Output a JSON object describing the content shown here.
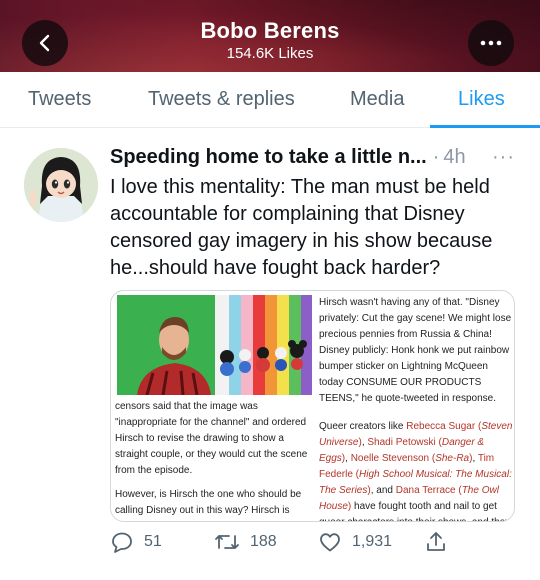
{
  "header": {
    "name": "Bobo Berens",
    "likes": "154.6K Likes"
  },
  "tabs": [
    {
      "label": "Tweets",
      "active": false
    },
    {
      "label": "Tweets & replies",
      "active": false
    },
    {
      "label": "Media",
      "active": false
    },
    {
      "label": "Likes",
      "active": true
    }
  ],
  "tweet": {
    "title": "Speeding home to take a little n...",
    "separator": "·",
    "time": "4h",
    "more": "···",
    "text": "I love this mentality: The man must be held accountable for complaining that Disney censored gay imagery in his show because he...should have fought back harder?",
    "media": {
      "left_p1": "censors said that the image was \"inappropriate for the channel\" and ordered Hirsch to revise the drawing to show a straight couple, or they would cut the scene from the episode.",
      "left_p2": "However, is Hirsch the one who should be calling Disney out in this way? Hirsch is cisgender and straight, and his show wasn't",
      "right_p1": "Hirsch wasn't having any of that. \"Disney privately: Cut the gay scene! We might lose precious pennies from Russia & China! Disney publicly: Honk honk we put rainbow bumper sticker on Lightning McQueen today CONSUME OUR PRODUCTS TEENS,\" he quote-tweeted in response.",
      "right_p2_prefix": "Queer creators like ",
      "creator1": "Rebecca Sugar",
      "creator1_show": "Steven Universe",
      "creator2": "Shadi Petowski",
      "creator2_show": "Danger & Eggs",
      "creator3": "Noelle Stevenson",
      "creator3_show": "She-Ra",
      "creator4": "Tim Federle",
      "creator4_show": "High School Musical: The Musical: The Series",
      "creator5": "Dana Terrace",
      "creator5_show": "The Owl House",
      "right_p2_suffix": " have fought tooth and nail to get queer characters into their shows, and they succeeded, without the straight, cis privilege that Hirsch has."
    },
    "replies": "51",
    "retweets": "188",
    "likes": "1,931"
  },
  "colors": {
    "accent": "#1d9bf0",
    "header_bg": "#6e1726",
    "link_red": "#b3352a",
    "muted": "#536471"
  },
  "icons": [
    "back-arrow-icon",
    "more-dots-icon",
    "reply-icon",
    "retweet-icon",
    "like-heart-icon",
    "share-icon"
  ]
}
